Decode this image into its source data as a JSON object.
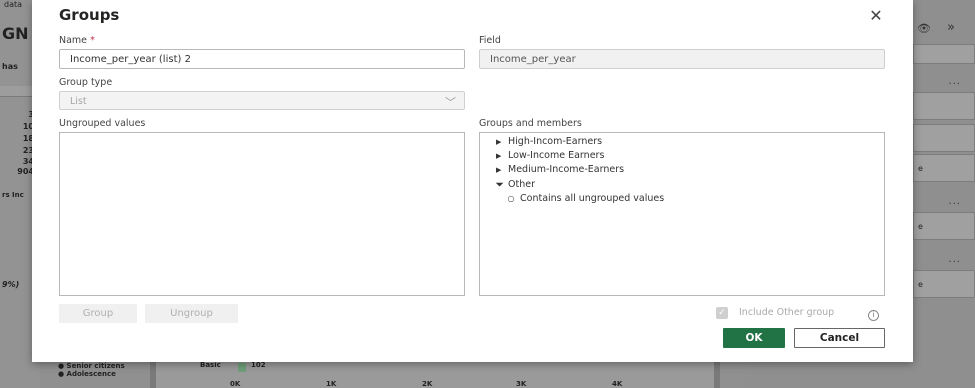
{
  "background": {
    "left_cells": [
      "data",
      "GN",
      "has",
      "3",
      "10",
      "18",
      "23",
      "34",
      "904",
      "rs Inc",
      "9%)"
    ],
    "right_texts": [
      "e",
      "e",
      "e"
    ],
    "bottom_legend": [
      "Senior citizens",
      "Adolescence"
    ],
    "bottom_chart": {
      "label": "Basic",
      "value": "102",
      "ticks": [
        "0K",
        "1K",
        "2K",
        "3K",
        "4K"
      ]
    }
  },
  "dialog": {
    "title": "Groups",
    "name_label": "Name",
    "required_mark": "*",
    "name_value": "Income_per_year (list) 2",
    "field_label": "Field",
    "field_value": "Income_per_year",
    "group_type_label": "Group type",
    "group_type_value": "List",
    "ungrouped_label": "Ungrouped values",
    "groups_label": "Groups and members",
    "groups": [
      {
        "label": "High-Incom-Earners",
        "expanded": false
      },
      {
        "label": "Low-Income Earners",
        "expanded": false
      },
      {
        "label": "Medium-Income-Earners",
        "expanded": false
      },
      {
        "label": "Other",
        "expanded": true
      }
    ],
    "other_member": "Contains all ungrouped values",
    "group_button": "Group",
    "ungroup_button": "Ungroup",
    "include_other_label": "Include Other group",
    "ok_button": "OK",
    "cancel_button": "Cancel"
  },
  "colors": {
    "ok_green": "#217346",
    "required_red": "#c4314b"
  }
}
